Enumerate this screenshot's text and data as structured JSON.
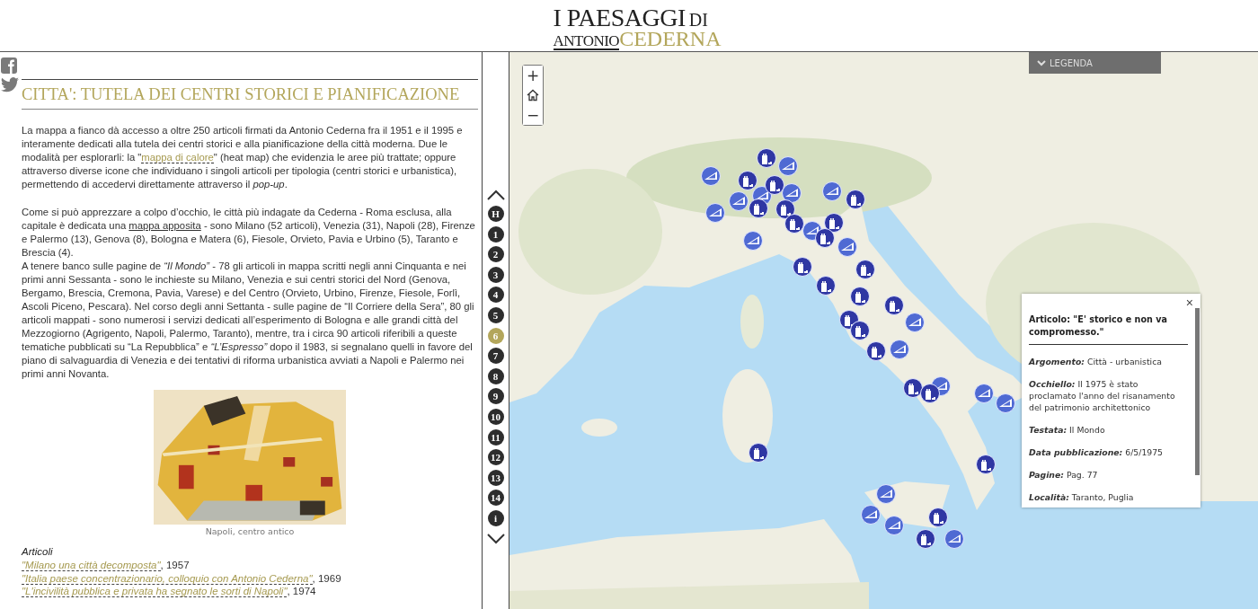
{
  "logo": {
    "title": "I PAESAGGI",
    "particle": "DI",
    "first_name": "ANTONIO",
    "surname": "CEDERNA"
  },
  "article": {
    "title": "CITTA': TUTELA DEI CENTRI STORICI E PIANIFICAZIONE",
    "paragraphs": [
      {
        "lines": [
          [
            {
              "kind": "text",
              "text": "La mappa a fianco dà accesso a oltre 250 articoli firmati da Antonio Cederna fra il 1951 e il 1995 e interamente dedicati alla tutela dei centri storici e alla pianificazione della città moderna. Due le modalità per esplorarli: la \""
            },
            {
              "kind": "dashed-link",
              "text": "mappa di calore"
            },
            {
              "kind": "text",
              "text": "\" (heat map) che evidenzia le aree più trattate; oppure attraverso diverse icone che individuano i singoli articoli per tipologia (centri storici e urbanistica), permettendo di accedervi direttamente attraverso il *pop-up*."
            }
          ]
        ]
      },
      {
        "lines": [
          [
            {
              "kind": "text",
              "text": "Come si può apprezzare a colpo d’occhio, le città più indagate da Cederna - Roma esclusa, alla capitale è dedicata una "
            },
            {
              "kind": "underline-link",
              "text": "mappa apposita"
            },
            {
              "kind": "text",
              "text": " - sono Milano (52 articoli), Venezia (31), Napoli (28), Firenze e Palermo (13), Genova (8), Bologna e Matera (6), Fiesole, Orvieto, Pavia e Urbino (5), Taranto e Brescia (4)."
            }
          ],
          [
            {
              "kind": "text",
              "text": "A tenere banco sulle pagine de *“Il Mondo”* - 78 gli articoli in mappa scritti negli anni Cinquanta e nei primi anni Sessanta - sono le inchieste su Milano, Venezia e sui centri storici del Nord (Genova, Bergamo, Brescia, Cremona, Pavia, Varese) e del Centro (Orvieto, Urbino, Firenze, Fiesole, Forlì, Ascoli Piceno, Pescara). Nel corso degli anni Settanta - sulle pagine de “Il Corriere della Sera”, 80 gli articoli mappati - sono numerosi i servizi dedicati all’esperimento di Bologna e alle grandi città del Mezzogiorno (Agrigento, Napoli, Palermo, Taranto), mentre, tra i circa 90 articoli riferibili a queste tematiche pubblicati su “La Repubblica” e *“L’Espresso”* dopo il 1983, si segnalano quelli in favore del piano di salvaguardia di Venezia e dei tentativi di riforma urbanistica avviati a Napoli e Palermo nei primi anni Novanta."
            }
          ]
        ]
      }
    ],
    "figure": {
      "kind": "picture",
      "caption": "Napoli, centro antico"
    },
    "articles_heading": "Articoli",
    "articles": [
      {
        "title": "\"Milano una città decomposta\"",
        "year": ", 1957"
      },
      {
        "title": "\"Italia paese concentrazionario, colloquio con Antonio Cederna\"",
        "year": ", 1969"
      },
      {
        "title": "\"L'incivilità pubblica e privata ha segnato le sorti di Napoli\"",
        "year": ", 1974"
      }
    ]
  },
  "nav": [
    {
      "label": "H",
      "selected": false
    },
    {
      "label": "1",
      "selected": false
    },
    {
      "label": "2",
      "selected": false
    },
    {
      "label": "3",
      "selected": false
    },
    {
      "label": "4",
      "selected": false
    },
    {
      "label": "5",
      "selected": false
    },
    {
      "label": "6",
      "selected": true
    },
    {
      "label": "7",
      "selected": false
    },
    {
      "label": "8",
      "selected": false
    },
    {
      "label": "9",
      "selected": false
    },
    {
      "label": "10",
      "selected": false
    },
    {
      "label": "11",
      "selected": false
    },
    {
      "label": "12",
      "selected": false
    },
    {
      "label": "13",
      "selected": false
    },
    {
      "label": "14",
      "selected": false
    },
    {
      "label": "i",
      "selected": false
    }
  ],
  "map": {
    "zoom_in": "+",
    "zoom_out": "−",
    "legend": "LEGENDA",
    "markers": [
      {
        "kind": "urbanistica"
      },
      {
        "kind": "urbanistica"
      },
      {
        "kind": "urbanistica"
      },
      {
        "kind": "urbanistica"
      },
      {
        "kind": "urbanistica"
      },
      {
        "kind": "urbanistica"
      },
      {
        "kind": "urbanistica"
      },
      {
        "kind": "urbanistica"
      },
      {
        "kind": "urbanistica"
      },
      {
        "kind": "urbanistica"
      },
      {
        "kind": "urbanistica"
      },
      {
        "kind": "urbanistica"
      },
      {
        "kind": "urbanistica"
      },
      {
        "kind": "urbanistica"
      },
      {
        "kind": "urbanistica"
      },
      {
        "kind": "urbanistica"
      },
      {
        "kind": "urbanistica"
      },
      {
        "kind": "urbanistica"
      },
      {
        "kind": "urbanistica"
      },
      {
        "kind": "centro"
      },
      {
        "kind": "centro"
      },
      {
        "kind": "centro"
      },
      {
        "kind": "centro"
      },
      {
        "kind": "centro"
      },
      {
        "kind": "centro"
      },
      {
        "kind": "centro"
      },
      {
        "kind": "centro"
      },
      {
        "kind": "centro"
      },
      {
        "kind": "centro"
      },
      {
        "kind": "centro"
      },
      {
        "kind": "centro"
      },
      {
        "kind": "centro"
      },
      {
        "kind": "centro"
      },
      {
        "kind": "centro"
      },
      {
        "kind": "centro"
      },
      {
        "kind": "centro"
      },
      {
        "kind": "centro"
      },
      {
        "kind": "centro"
      },
      {
        "kind": "centro"
      },
      {
        "kind": "centro"
      },
      {
        "kind": "centro"
      },
      {
        "kind": "centro"
      }
    ],
    "popup": {
      "close": "×",
      "title": "Articolo: \"E' storico e non va compromesso.\"",
      "fields": [
        {
          "label": "Argomento:",
          "value": "Città - urbanistica"
        },
        {
          "label": "Occhiello:",
          "value": "Il 1975 è stato proclamato l'anno del risanamento del patrimonio architettonico"
        },
        {
          "label": "Testata:",
          "value": "Il Mondo"
        },
        {
          "label": "Data pubblicazione:",
          "value": "6/5/1975"
        },
        {
          "label": "Pagine:",
          "value": "Pag. 77"
        },
        {
          "label": "Località:",
          "value": "Taranto, Puglia"
        }
      ]
    }
  }
}
